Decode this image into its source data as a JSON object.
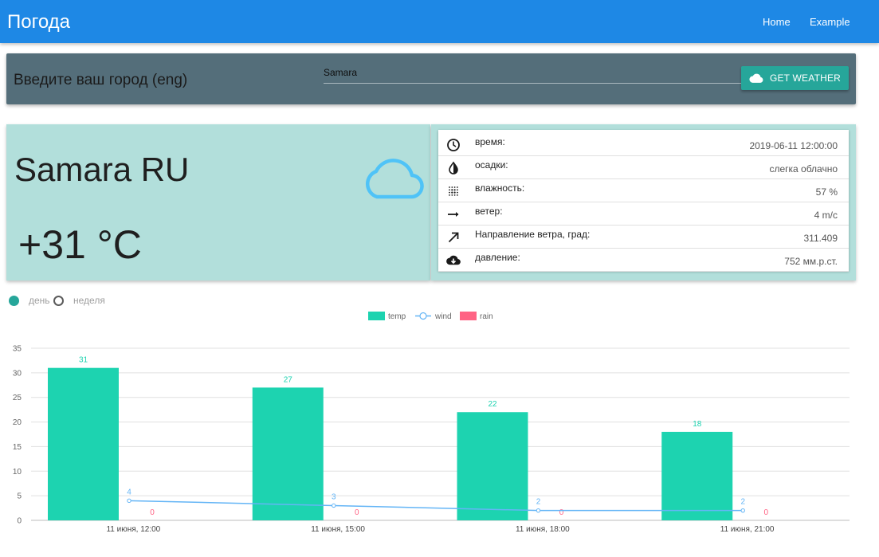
{
  "navbar": {
    "brand": "Погода",
    "links": [
      "Home",
      "Example"
    ],
    "color": "#1e88e5"
  },
  "search": {
    "prompt": "Введите ваш город (eng)",
    "value": "Samara",
    "button_label": "GET WEATHER",
    "button_icon": "cloud-icon"
  },
  "current": {
    "city": "Samara RU",
    "temperature": "+31 °C",
    "icon": "cloud-icon"
  },
  "details": [
    {
      "icon": "clock-icon",
      "label": "время:",
      "value": "2019-06-11 12:00:00"
    },
    {
      "icon": "contrast-icon",
      "label": "осадки:",
      "value": "слегка облачно"
    },
    {
      "icon": "dots-grid-icon",
      "label": "влажность:",
      "value": "57 %"
    },
    {
      "icon": "arrow-right-icon",
      "label": "ветер:",
      "value": "4 m/c"
    },
    {
      "icon": "arrow-diagonal-icon",
      "label": "Направление ветра, град:",
      "value": "311.409"
    },
    {
      "icon": "cloud-download-icon",
      "label": "давление:",
      "value": "752 мм.р.ст."
    }
  ],
  "toggle": {
    "day": "день",
    "week": "неделя",
    "selected": "day"
  },
  "chart_data": {
    "type": "bar",
    "categories": [
      "11 июня, 12:00",
      "11 июня, 15:00",
      "11 июня, 18:00",
      "11 июня, 21:00"
    ],
    "series": [
      {
        "name": "temp",
        "kind": "bar",
        "color": "#1dd3b0",
        "values": [
          31,
          27,
          22,
          18
        ]
      },
      {
        "name": "wind",
        "kind": "line",
        "color": "#64b5f6",
        "values": [
          4,
          3,
          2,
          2
        ]
      },
      {
        "name": "rain",
        "kind": "bar",
        "color": "#ff6384",
        "values": [
          0,
          0,
          0,
          0
        ]
      }
    ],
    "ylim": [
      0,
      35
    ],
    "yticks": [
      0,
      5,
      10,
      15,
      20,
      25,
      30,
      35
    ],
    "grid": true,
    "legend": "top-center"
  }
}
